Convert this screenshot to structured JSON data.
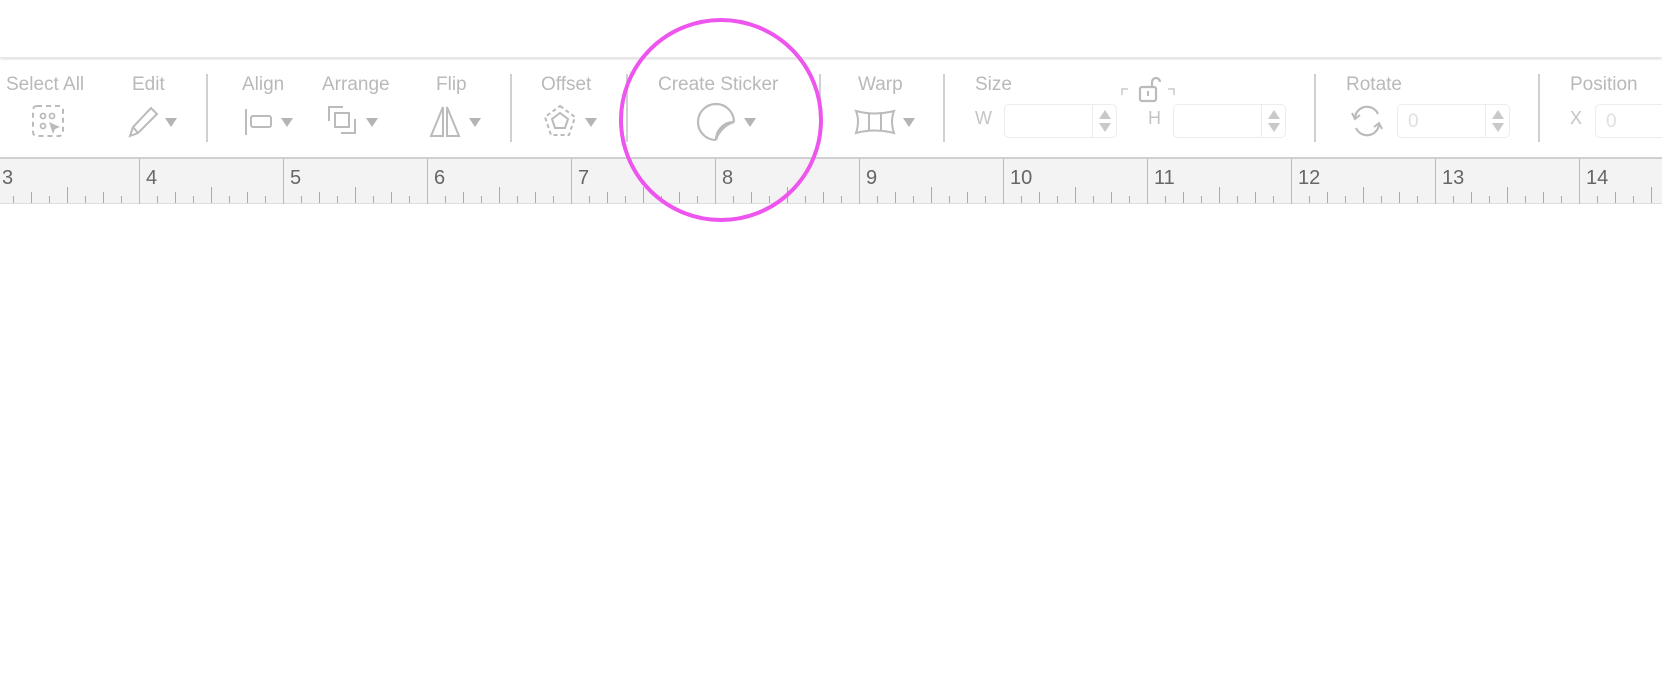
{
  "toolbar": {
    "select_all": "Select All",
    "edit": "Edit",
    "align": "Align",
    "arrange": "Arrange",
    "flip": "Flip",
    "offset": "Offset",
    "create_sticker": "Create Sticker",
    "warp": "Warp",
    "size": "Size",
    "size_w_label": "W",
    "size_h_label": "H",
    "size_w_value": "",
    "size_h_value": "",
    "rotate": "Rotate",
    "rotate_value": "0",
    "position": "Position",
    "position_x_label": "X",
    "position_x_value": "0"
  },
  "ruler": {
    "labels": [
      "3",
      "4",
      "5",
      "6",
      "7",
      "8",
      "9",
      "10",
      "11",
      "12",
      "13",
      "14"
    ]
  },
  "colors": {
    "highlight": "#ee55ee",
    "disabled_text": "#b9b9b9"
  }
}
